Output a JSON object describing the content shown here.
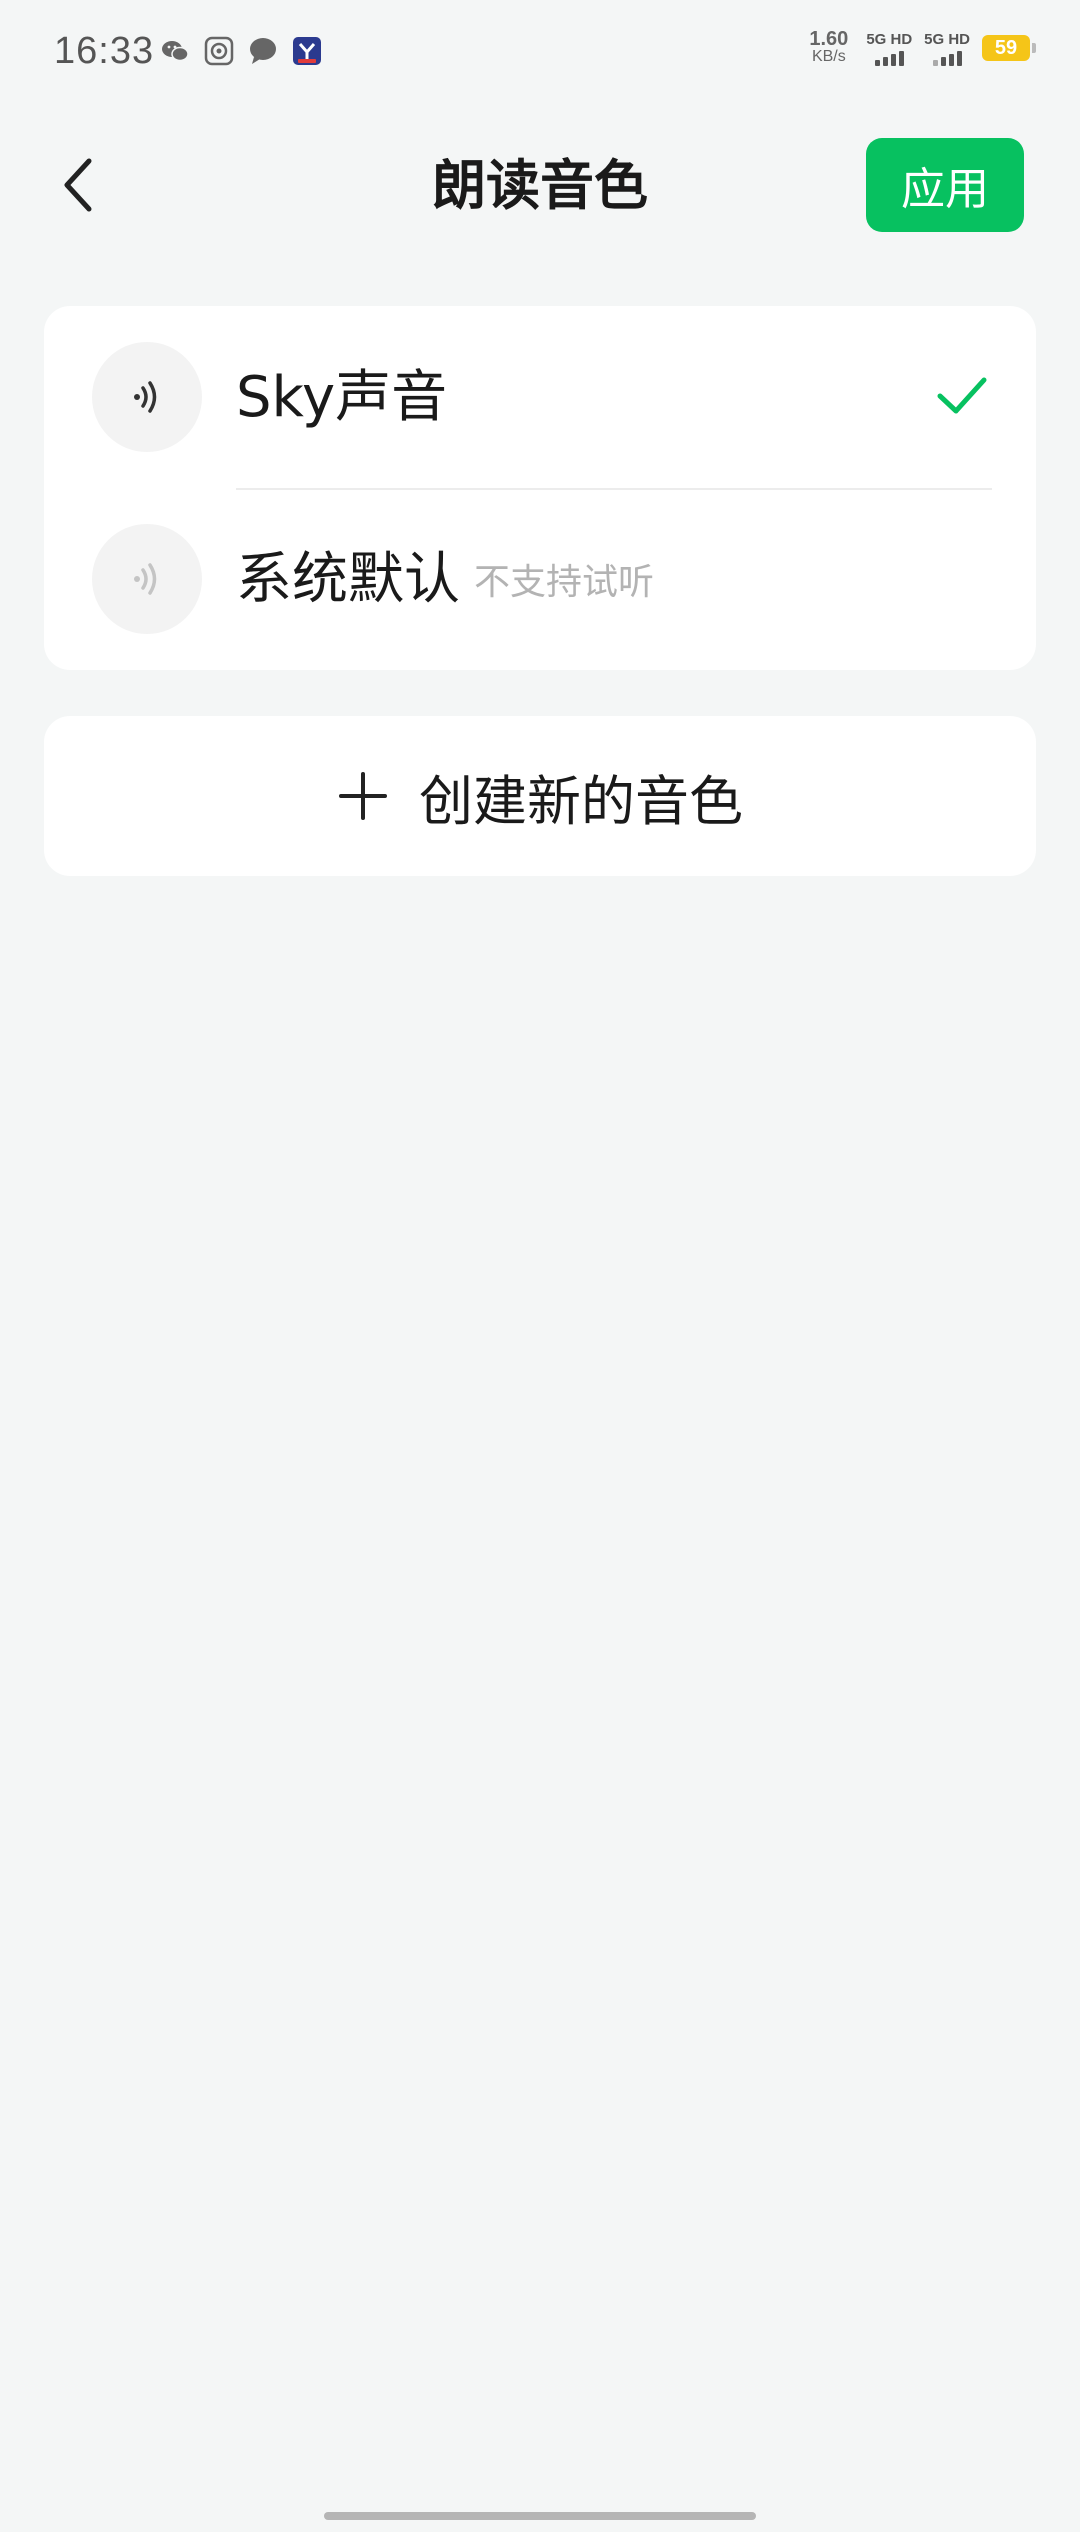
{
  "status_bar": {
    "time": "16:33",
    "net_speed_value": "1.60",
    "net_speed_unit": "KB/s",
    "sim1_label": "5G HD",
    "sim2_label": "5G HD",
    "battery_level": "59",
    "notification_icons": [
      "wechat-icon",
      "camera-app-icon",
      "message-bubble-icon",
      "app-badge-icon"
    ],
    "battery_color": "#f5c518"
  },
  "header": {
    "title": "朗读音色",
    "apply_label": "应用",
    "accent_color": "#07c160"
  },
  "voice_list": {
    "items": [
      {
        "name": "Sky声音",
        "note": "",
        "selected": true,
        "icon": "sound-wave-icon"
      },
      {
        "name": "系统默认",
        "note": "不支持试听",
        "selected": false,
        "icon": "sound-wave-icon"
      }
    ]
  },
  "create_voice": {
    "icon": "plus-icon",
    "label": "创建新的音色"
  }
}
